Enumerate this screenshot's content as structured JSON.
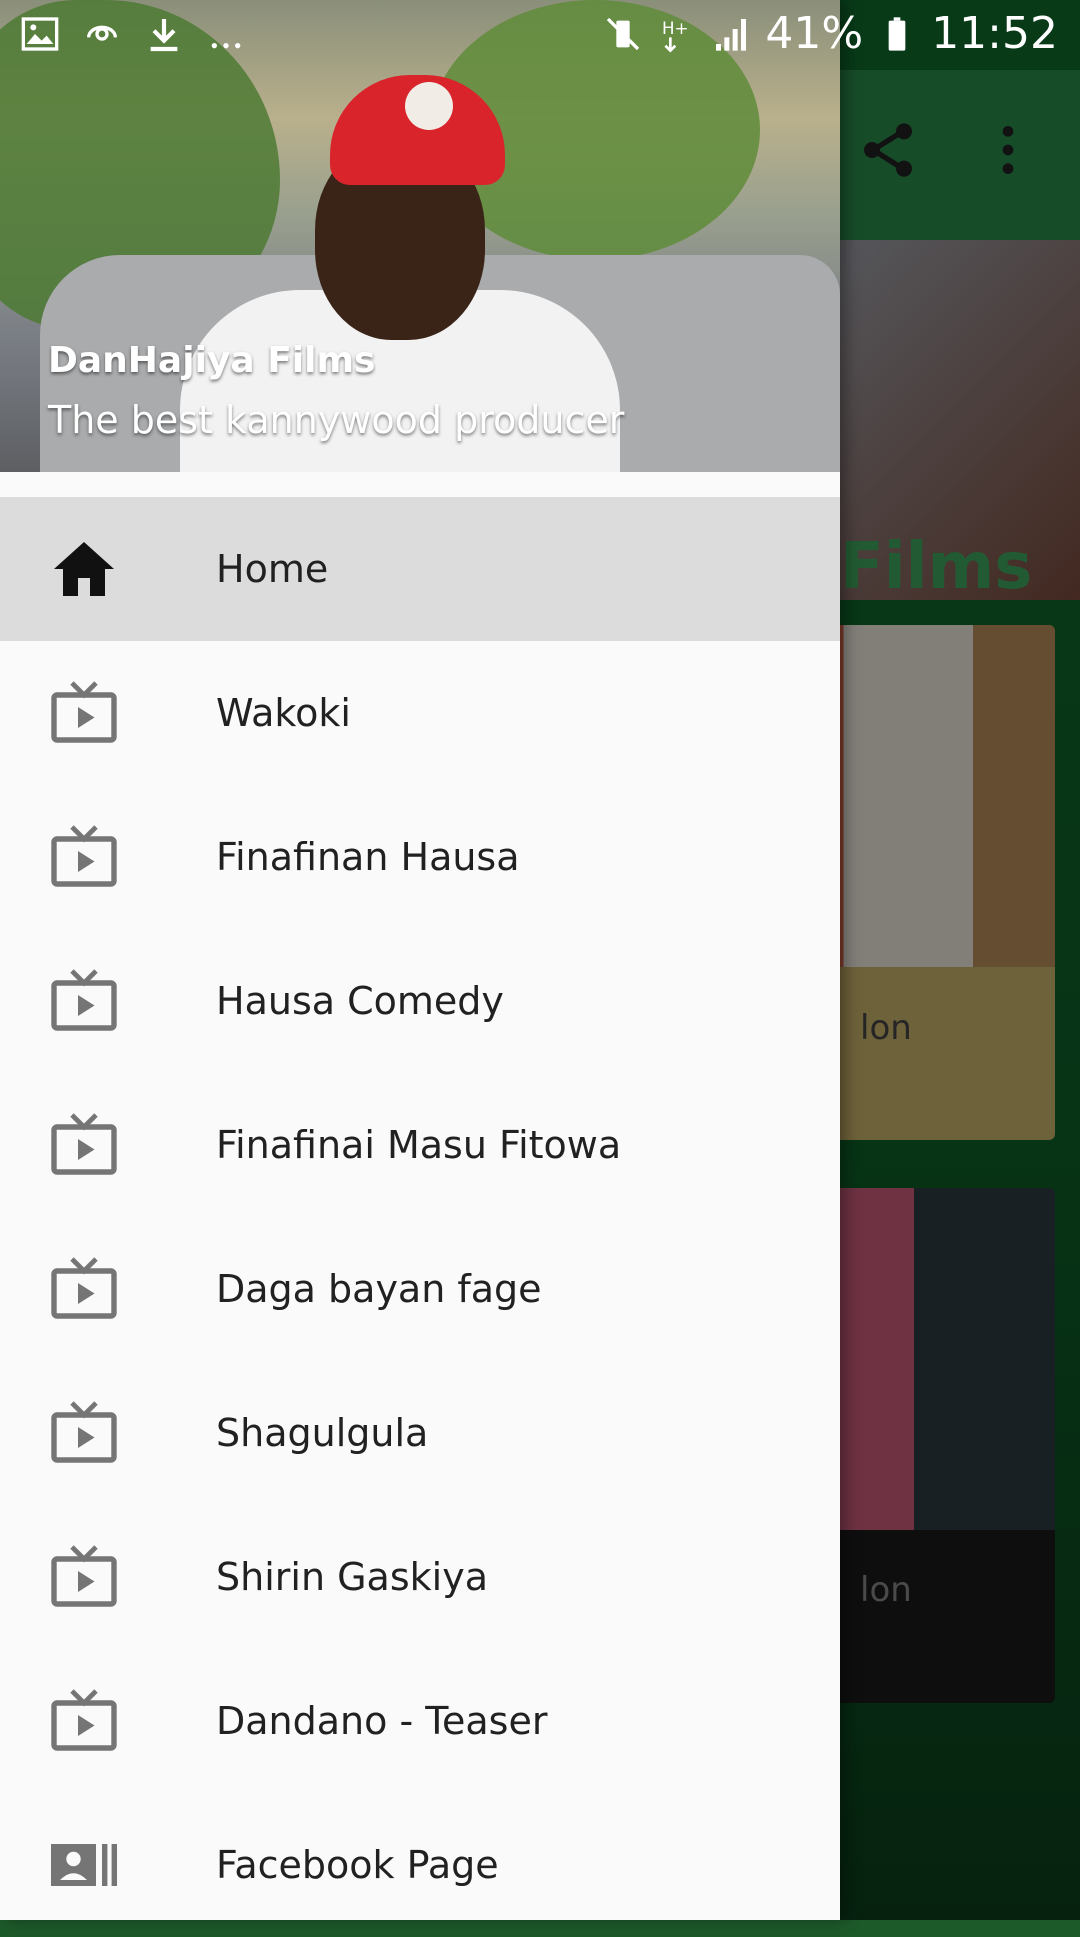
{
  "status_bar": {
    "battery": "41%",
    "time": "11:52",
    "left_icons": [
      "image-icon",
      "sync-icon",
      "download-icon",
      "more-notifications-icon"
    ],
    "right_icons": [
      "vibrate-mute-icon",
      "h-plus-data-icon",
      "signal-icon",
      "battery-icon"
    ]
  },
  "drawer": {
    "header": {
      "title": "DanHajiya Films",
      "subtitle": "The best kannywood producer"
    },
    "items": [
      {
        "label": "Home",
        "icon": "home-icon",
        "active": true
      },
      {
        "label": "Wakoki",
        "icon": "tv-play-icon"
      },
      {
        "label": "Finafinan Hausa",
        "icon": "tv-play-icon"
      },
      {
        "label": "Hausa Comedy",
        "icon": "tv-play-icon"
      },
      {
        "label": "Finafinai Masu Fitowa",
        "icon": "tv-play-icon"
      },
      {
        "label": "Daga bayan fage",
        "icon": "tv-play-icon"
      },
      {
        "label": "Shagulgula",
        "icon": "tv-play-icon"
      },
      {
        "label": "Shirin Gaskiya",
        "icon": "tv-play-icon"
      },
      {
        "label": "Dandano - Teaser",
        "icon": "tv-play-icon"
      },
      {
        "label": "Facebook Page",
        "icon": "contact-card-icon"
      }
    ]
  },
  "background_app": {
    "banner_text": "Films",
    "card1_title": "lon",
    "card2_title": "lon",
    "accent_color": "#2a8a4c"
  }
}
